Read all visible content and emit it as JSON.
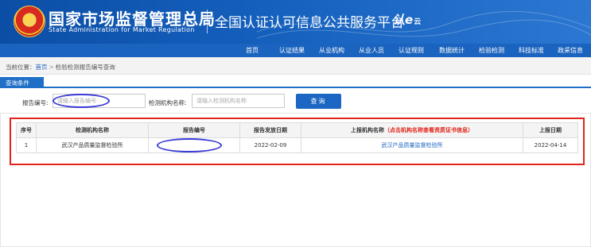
{
  "header": {
    "agency_cn": "国家市场监督管理总局",
    "agency_en": "State Administration  for  Market Regulation",
    "platform_title": "全国认证认可信息公共服务平台",
    "logo_mark": "认e",
    "logo_mark_suffix": "云"
  },
  "nav": {
    "items": [
      {
        "label": "首页"
      },
      {
        "label": "认证结果"
      },
      {
        "label": "从业机构"
      },
      {
        "label": "从业人员"
      },
      {
        "label": "认证规则"
      },
      {
        "label": "数据统计"
      },
      {
        "label": "检验检测"
      },
      {
        "label": "科技标准"
      },
      {
        "label": "政采信息"
      }
    ]
  },
  "breadcrumb": {
    "prefix": "当前位置：",
    "home": "首页",
    "separator": ">",
    "current": "检验检测报告编号查询"
  },
  "query": {
    "section_label": "查询条件",
    "report_no_label": "报告编号:",
    "report_no_placeholder": "请输入报告编号",
    "report_no_value": "",
    "org_name_label": "检测机构名称:",
    "org_name_placeholder": "请输入检测机构名称",
    "org_name_value": "",
    "submit_label": "查询"
  },
  "results": {
    "columns": {
      "seq": "序号",
      "org_name": "检测机构名称",
      "report_no": "报告编号",
      "issue_date": "报告发放日期",
      "reporting_org": "上报机构名称",
      "reporting_org_note": "（点击机构名称查看资质证书信息）",
      "report_date": "上报日期"
    },
    "rows": [
      {
        "seq": "1",
        "org_name": "武汉产品质量监督检验所",
        "report_no": "",
        "issue_date": "2022-02-09",
        "reporting_org": "武汉产品质量监督检验所",
        "report_date": "2022-04-14"
      }
    ]
  },
  "colors": {
    "header_blue": "#0b4ea6",
    "nav_blue": "#1a63bf",
    "highlight_red": "#e2231a",
    "annotation_blue": "#3a3bd6"
  }
}
